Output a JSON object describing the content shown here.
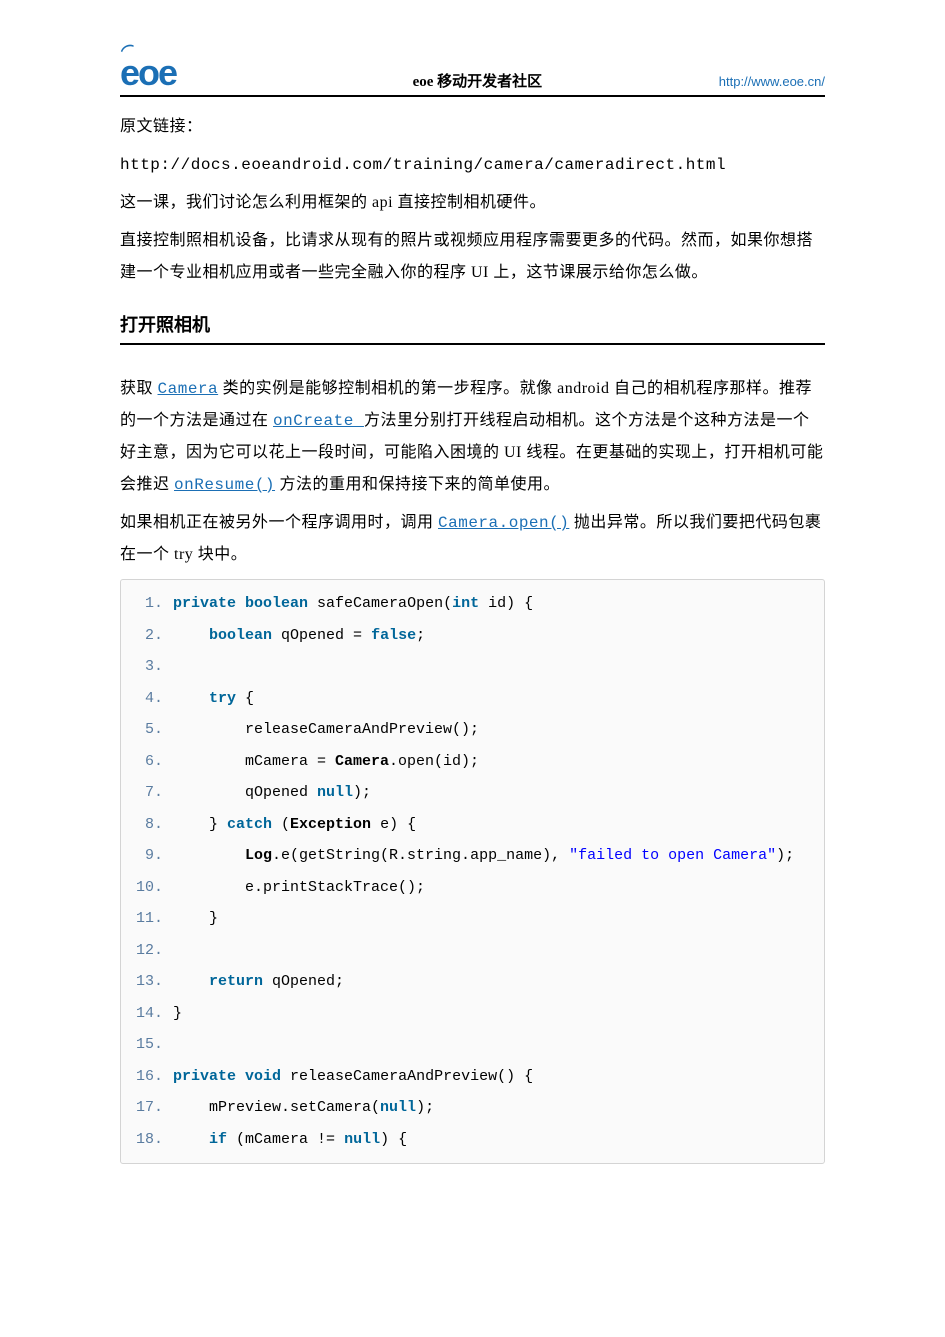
{
  "header": {
    "logo_text": "eoe",
    "center": "eoe 移动开发者社区",
    "url": "http://www.eoe.cn/"
  },
  "intro": {
    "label": "原文链接：",
    "url": "http://docs.eoeandroid.com/training/camera/cameradirect.html",
    "p1": "这一课，我们讨论怎么利用框架的 api 直接控制相机硬件。",
    "p2": "直接控制照相机设备，比请求从现有的照片或视频应用程序需要更多的代码。然而，如果你想搭建一个专业相机应用或者一些完全融入你的程序 UI 上，这节课展示给你怎么做。"
  },
  "section_title": "打开照相机",
  "paragraph": {
    "seg0": "获取 ",
    "link0": "Camera",
    "seg1": " 类的实例是能够控制相机的第一步程序。就像 android 自己的相机程序那样。推荐的一个方法是通过在 ",
    "link1": "onCreate ",
    "seg2": "方法里分别打开线程启动相机。这个方法是个这种方法是一个好主意，因为它可以花上一段时间，可能陷入困境的 UI 线程。在更基础的实现上，打开相机可能会推迟 ",
    "link2": "onResume()",
    "seg3": " 方法的重用和保持接下来的简单使用。",
    "seg4": "如果相机正在被另外一个程序调用时，调用 ",
    "link3": "Camera.open()",
    "seg5": "抛出异常。所以我们要把代码包裹在一个 try 块中。"
  },
  "code": {
    "lines": [
      {
        "n": "1.",
        "html": "<span class='kw'>private</span> <span class='kw'>boolean</span> safeCameraOpen(<span class='kw'>int</span> id) {"
      },
      {
        "n": "2.",
        "html": "    <span class='kw'>boolean</span> qOpened = <span class='kw'>false</span>;"
      },
      {
        "n": "3.",
        "html": "  "
      },
      {
        "n": "4.",
        "html": "    <span class='kw'>try</span> {"
      },
      {
        "n": "5.",
        "html": "        releaseCameraAndPreview();"
      },
      {
        "n": "6.",
        "html": "        mCamera = <span class='type'>Camera</span>.open(id);"
      },
      {
        "n": "7.",
        "html": "        qOpened <span class='kw'>null</span>);"
      },
      {
        "n": "8.",
        "html": "    } <span class='kw'>catch</span> (<span class='type'>Exception</span> e) {"
      },
      {
        "n": "9.",
        "html": "        <span class='type'>Log</span>.e(getString(R.string.app_name), <span class='str'>\"failed to open Camera\"</span>);"
      },
      {
        "n": "10.",
        "html": "        e.printStackTrace();"
      },
      {
        "n": "11.",
        "html": "    }"
      },
      {
        "n": "12.",
        "html": ""
      },
      {
        "n": "13.",
        "html": "    <span class='kw'>return</span> qOpened;"
      },
      {
        "n": "14.",
        "html": "}"
      },
      {
        "n": "15.",
        "html": ""
      },
      {
        "n": "16.",
        "html": "<span class='kw'>private</span> <span class='kw'>void</span> releaseCameraAndPreview() {"
      },
      {
        "n": "17.",
        "html": "    mPreview.setCamera(<span class='kw'>null</span>);"
      },
      {
        "n": "18.",
        "html": "    <span class='kw'>if</span> (mCamera != <span class='kw'>null</span>) {"
      }
    ]
  }
}
